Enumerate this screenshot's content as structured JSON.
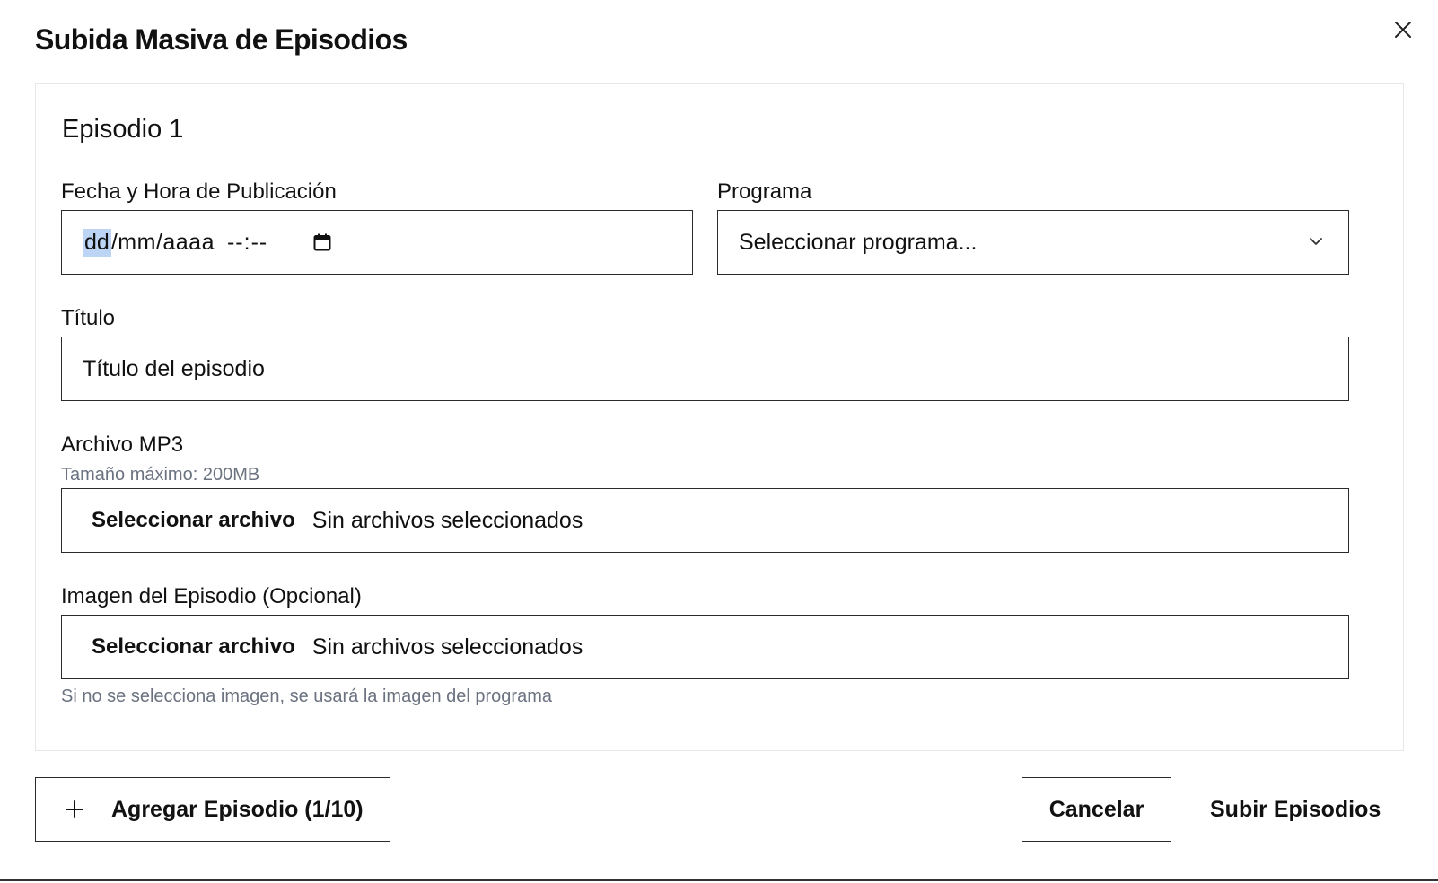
{
  "dialog": {
    "title": "Subida Masiva de Episodios",
    "close_icon": "close-icon"
  },
  "episode": {
    "heading": "Episodio 1",
    "date": {
      "label": "Fecha y Hora de Publicación",
      "dd": "dd",
      "rest": "/mm/aaaa",
      "time": "--:--",
      "icon": "calendar-icon"
    },
    "program": {
      "label": "Programa",
      "selected": "Seleccionar programa...",
      "icon": "chevron-down-icon"
    },
    "title_field": {
      "label": "Título",
      "placeholder": "Título del episodio"
    },
    "mp3": {
      "label": "Archivo MP3",
      "hint": "Tamaño máximo: 200MB",
      "button": "Seleccionar archivo",
      "status": "Sin archivos seleccionados"
    },
    "image": {
      "label": "Imagen del Episodio (Opcional)",
      "button": "Seleccionar archivo",
      "status": "Sin archivos seleccionados",
      "hint": "Si no se selecciona imagen, se usará la imagen del programa"
    }
  },
  "footer": {
    "add_label": "Agregar Episodio (1/10)",
    "add_icon": "plus-icon",
    "cancel_label": "Cancelar",
    "submit_label": "Subir Episodios"
  },
  "colors": {
    "border": "#2b2b2b",
    "card_border": "#e5e7eb",
    "hint_text": "#6b7280",
    "selection": "#bcd5f5"
  }
}
